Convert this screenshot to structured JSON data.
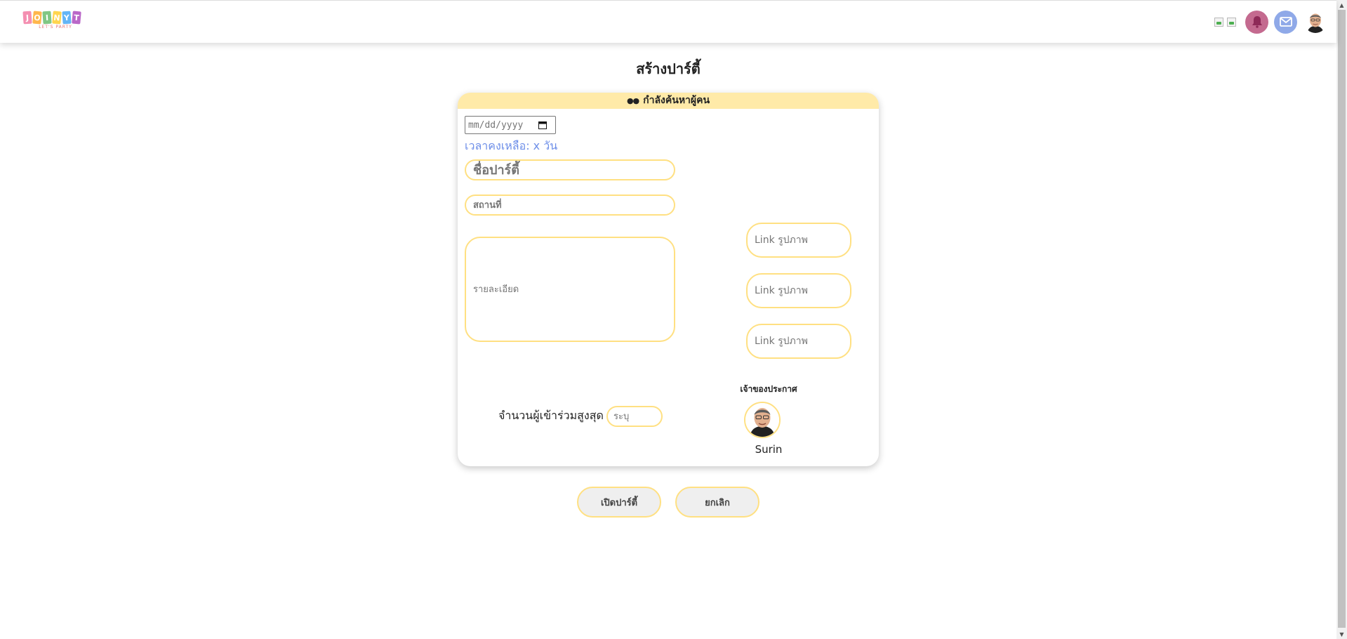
{
  "header": {
    "logo_letters": [
      "J",
      "O",
      "I",
      "N",
      "Y",
      "T"
    ],
    "logo_letter_colors": [
      "#f48fb1",
      "#ffb74d",
      "#81c784",
      "#ffd54f",
      "#64b5f6",
      "#ba68c8"
    ],
    "logo_tagline": "LET'S PARTY",
    "notification_icon": "bell-icon",
    "mail_icon": "mail-icon"
  },
  "page": {
    "title": "สร้างปาร์ตี้"
  },
  "card": {
    "status": "กำลังค้นหาผู้คน",
    "date_placeholder": "mm/dd/yyyy",
    "time_left": "เวลาคงเหลือ: x วัน",
    "party_name_placeholder": "ชื่อปาร์ตี้",
    "place_placeholder": "สถานที่",
    "details_placeholder": "รายละเอียด",
    "image_links": [
      {
        "placeholder": "Link รูปภาพ"
      },
      {
        "placeholder": "Link รูปภาพ"
      },
      {
        "placeholder": "Link รูปภาพ"
      }
    ],
    "max_participants_label": "จำนวนผู้เข้าร่วมสูงสุด",
    "max_participants_placeholder": "ระบุ",
    "owner_label": "เจ้าของประกาศ",
    "owner_name": "Surin"
  },
  "actions": {
    "open_party": "เปิดปาร์ตี้",
    "cancel": "ยกเลิก"
  },
  "colors": {
    "accent_yellow": "#ffe082",
    "status_bg": "#ffeaa8",
    "time_left_blue": "#6d8ee8",
    "bell_bg": "#c46a8f",
    "mail_bg": "#8fa9e8"
  }
}
